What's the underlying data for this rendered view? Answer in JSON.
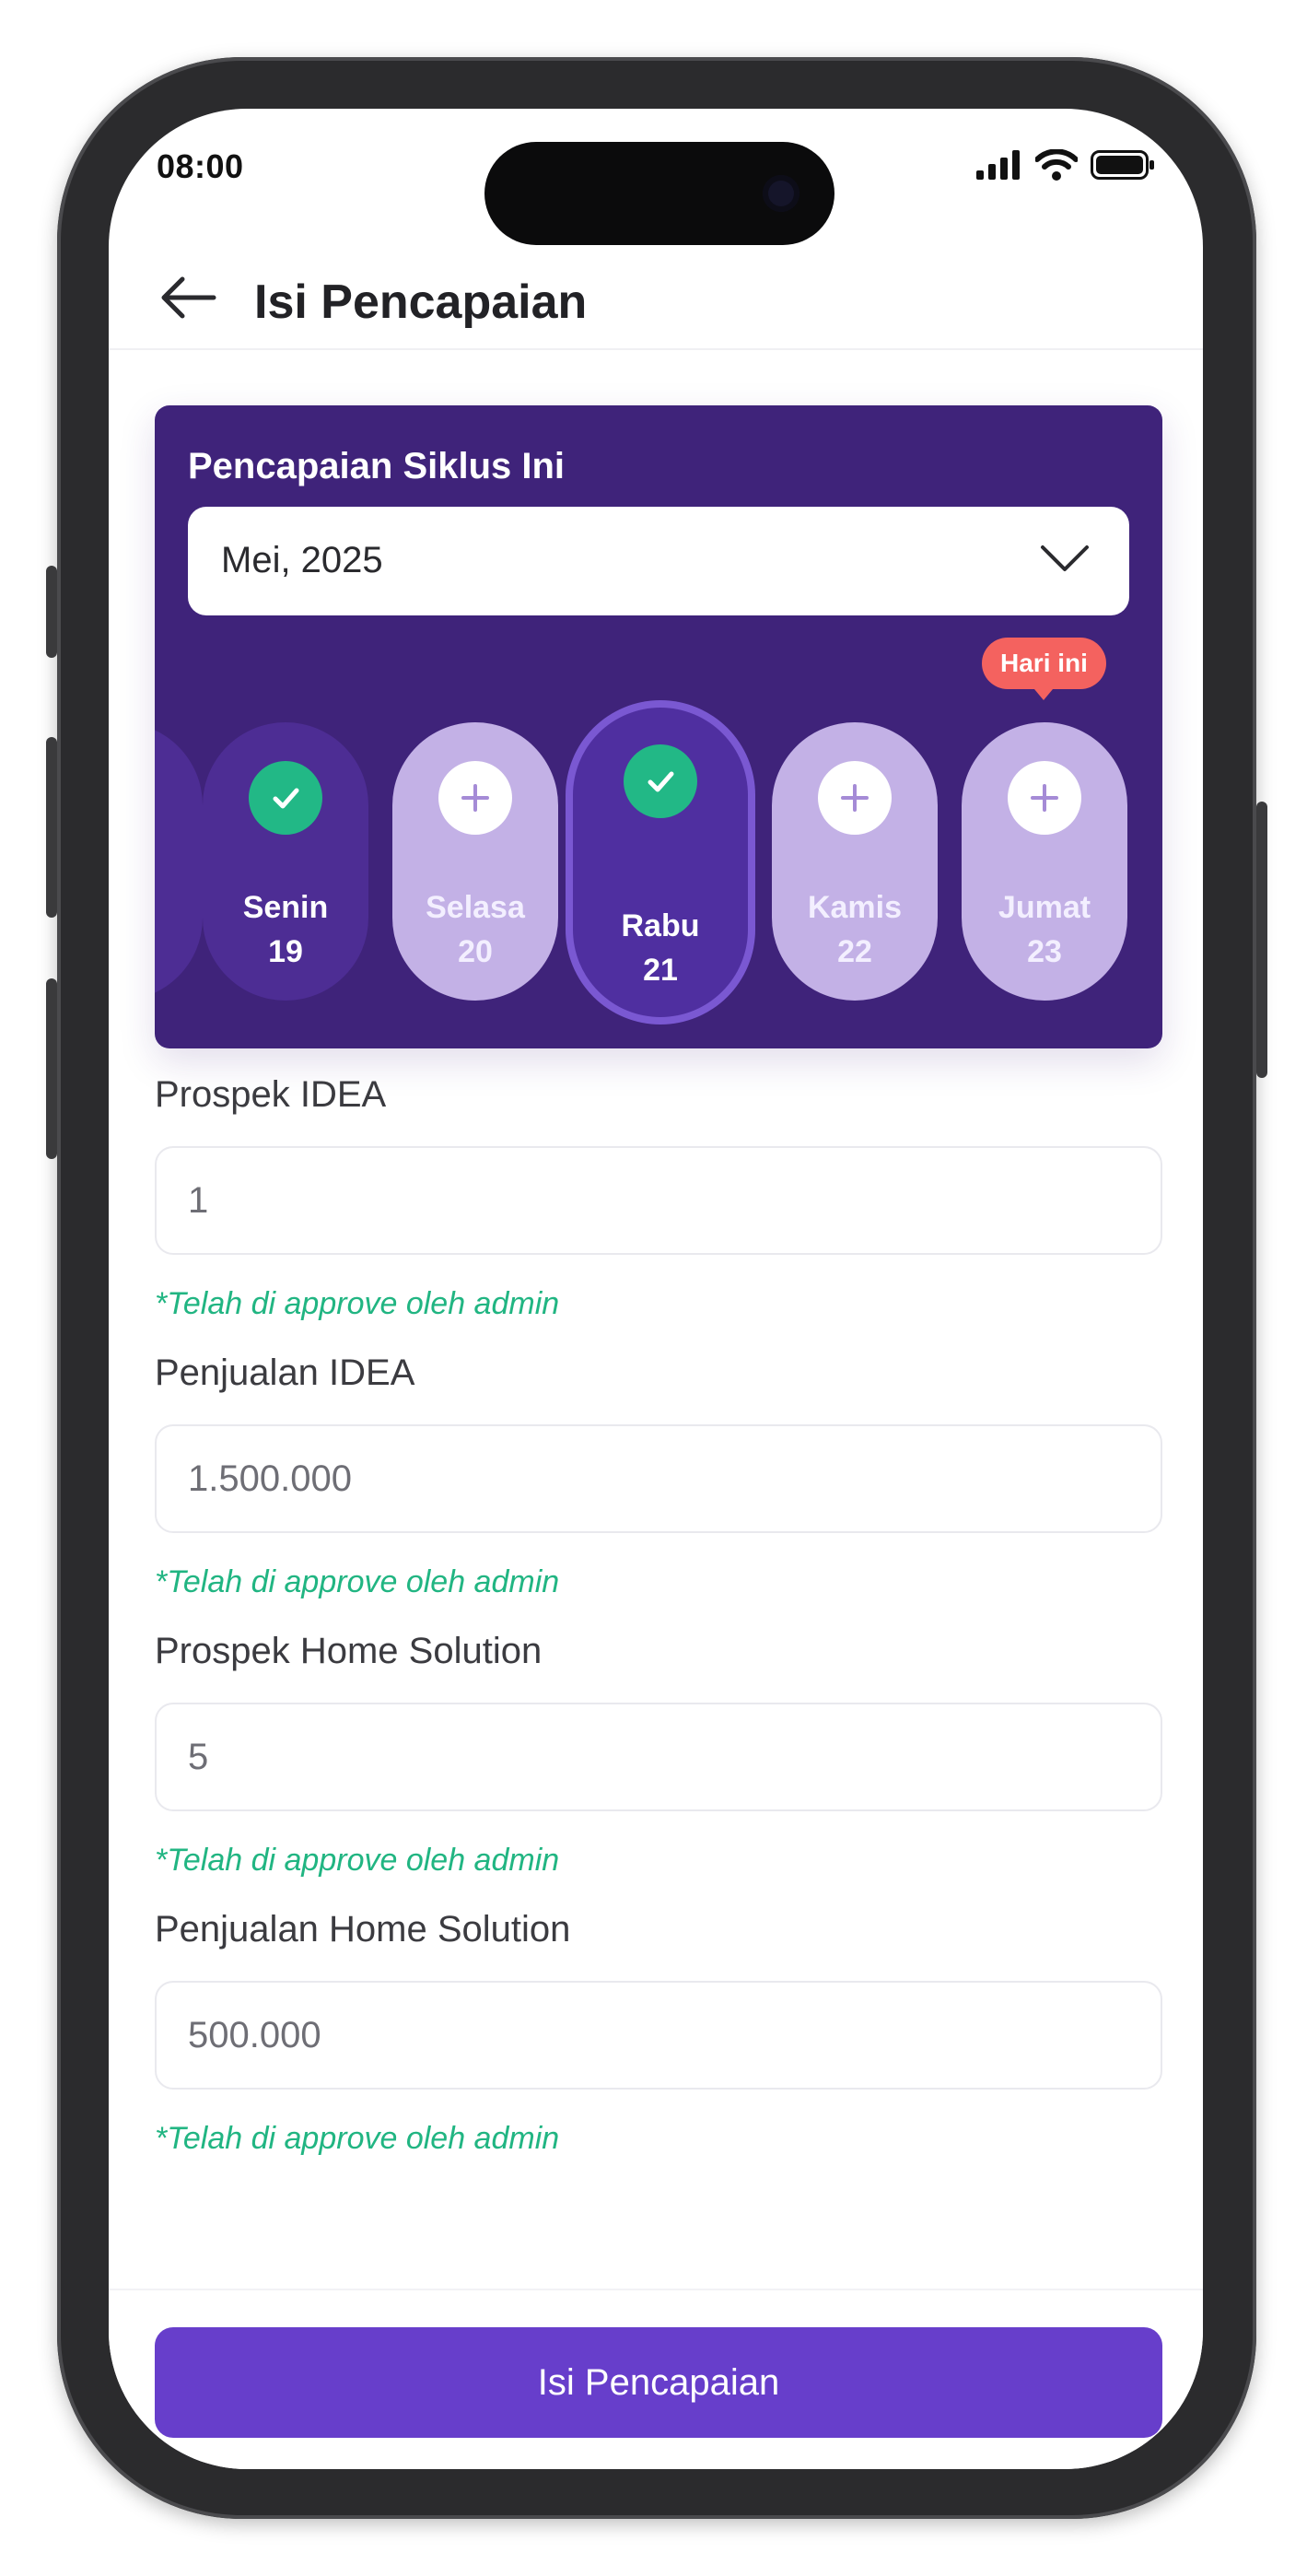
{
  "status_bar": {
    "time": "08:00"
  },
  "header": {
    "title": "Isi Pencapaian"
  },
  "cycle_card": {
    "title": "Pencapaian Siklus Ini",
    "month": "Mei, 2025",
    "today_badge": "Hari ini",
    "days": [
      {
        "name": "Senin",
        "date": "19",
        "status": "done"
      },
      {
        "name": "Selasa",
        "date": "20",
        "status": "todo"
      },
      {
        "name": "Rabu",
        "date": "21",
        "status": "done",
        "selected": true
      },
      {
        "name": "Kamis",
        "date": "22",
        "status": "todo"
      },
      {
        "name": "Jumat",
        "date": "23",
        "status": "todo",
        "today": true
      }
    ]
  },
  "form": {
    "fields": [
      {
        "label": "Prospek IDEA",
        "value": "1",
        "note": "*Telah di approve oleh admin"
      },
      {
        "label": "Penjualan IDEA",
        "value": "1.500.000",
        "note": "*Telah di approve oleh admin"
      },
      {
        "label": "Prospek Home Solution",
        "value": "5",
        "note": "*Telah di approve oleh admin"
      },
      {
        "label": "Penjualan Home Solution",
        "value": "500.000",
        "note": "*Telah di approve oleh admin"
      }
    ]
  },
  "footer": {
    "submit_label": "Isi Pencapaian"
  },
  "colors": {
    "card_bg": "#3f237a",
    "primary": "#673ecb",
    "success": "#21b582",
    "badge": "#f4625f",
    "day_pending": "#c3b1e6"
  }
}
